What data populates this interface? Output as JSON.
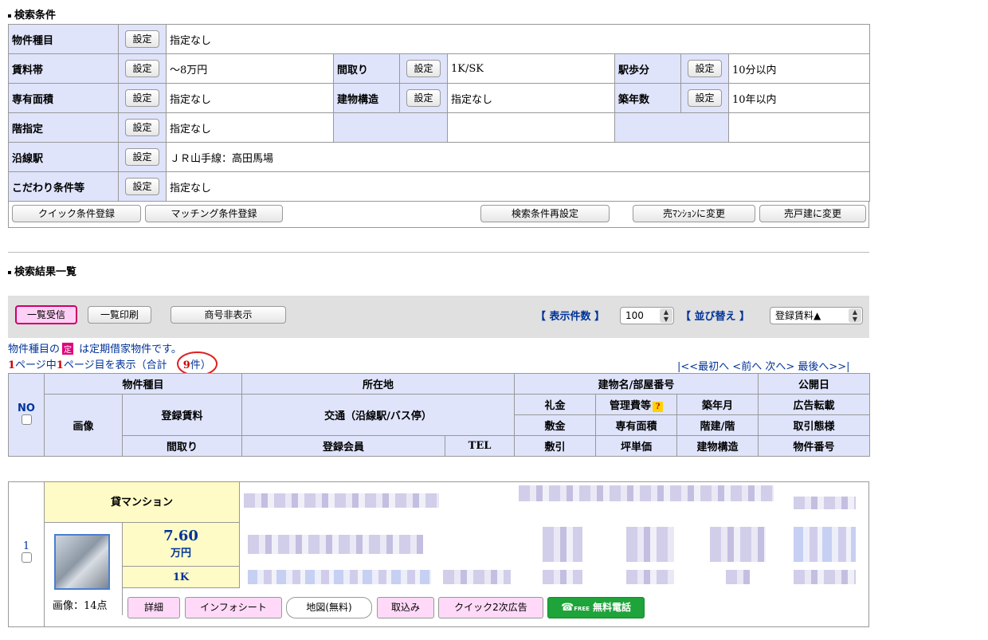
{
  "search_conditions": {
    "title": "検索条件",
    "set_button": "設定",
    "rows": {
      "property_type": {
        "label": "物件種目",
        "value": "指定なし"
      },
      "rent_range": {
        "label": "賃料帯",
        "value": "〜8万円"
      },
      "layout": {
        "label": "間取り",
        "value": "1K/SK"
      },
      "walk": {
        "label": "駅歩分",
        "value": "10分以内"
      },
      "area": {
        "label": "専有面積",
        "value": "指定なし"
      },
      "structure": {
        "label": "建物構造",
        "value": "指定なし"
      },
      "age": {
        "label": "築年数",
        "value": "10年以内"
      },
      "floor": {
        "label": "階指定",
        "value": "指定なし"
      },
      "station": {
        "label": "沿線駅",
        "value": "ＪＲ山手線：高田馬場"
      },
      "special": {
        "label": "こだわり条件等",
        "value": "指定なし"
      }
    },
    "actions": {
      "quick_register": "クイック条件登録",
      "matching_register": "マッチング条件登録",
      "reset": "検索条件再設定",
      "to_mansion": "売ﾏﾝｼｮﾝに変更",
      "to_house": "売戸建に変更"
    }
  },
  "results": {
    "title": "検索結果一覧",
    "toolbar": {
      "receive_list": "一覧受信",
      "print_list": "一覧印刷",
      "hide_trade_name": "商号非表示",
      "per_page_label": "【 表示件数 】",
      "per_page_value": "100",
      "sort_label": "【 並び替え 】",
      "sort_value": "登録賃料▲"
    },
    "note_prefix": "物件種目の",
    "note_badge": "定",
    "note_suffix": " は定期借家物件です。",
    "page_info": {
      "total_pages": "1",
      "mid1": "ページ中",
      "current_page": "1",
      "mid2": "ページ目を表示（合計",
      "count": "9",
      "suffix": "件）"
    },
    "pager": "|<<最初へ <前へ 次へ> 最後へ>>|",
    "headers": {
      "no": "NO",
      "property_type": "物件種目",
      "location": "所在地",
      "building": "建物名/部屋番号",
      "published": "公開日",
      "image": "画像",
      "rent": "登録賃料",
      "traffic": "交通（沿線駅/バス停）",
      "key_money": "礼金",
      "mgmt_fee": "管理費等",
      "built": "築年月",
      "ad": "広告転載",
      "deposit": "敷金",
      "area": "専有面積",
      "floors": "階建/階",
      "trade": "取引態様",
      "layout": "間取り",
      "member": "登録会員",
      "tel": "TEL",
      "deduction": "敷引",
      "unit_price": "坪単価",
      "structure": "建物構造",
      "property_no": "物件番号"
    },
    "row": {
      "no": "1",
      "type": "貸マンション",
      "rent_value": "7.60",
      "rent_unit": "万円",
      "layout": "1K",
      "image_count": "画像：14点",
      "buttons": {
        "detail": "詳細",
        "info_sheet": "インフォシート",
        "map": "地図(無料)",
        "import": "取込み",
        "quick_ad": "クイック2次広告",
        "free_call": "無料電話",
        "free_tag": "FREE"
      }
    }
  }
}
